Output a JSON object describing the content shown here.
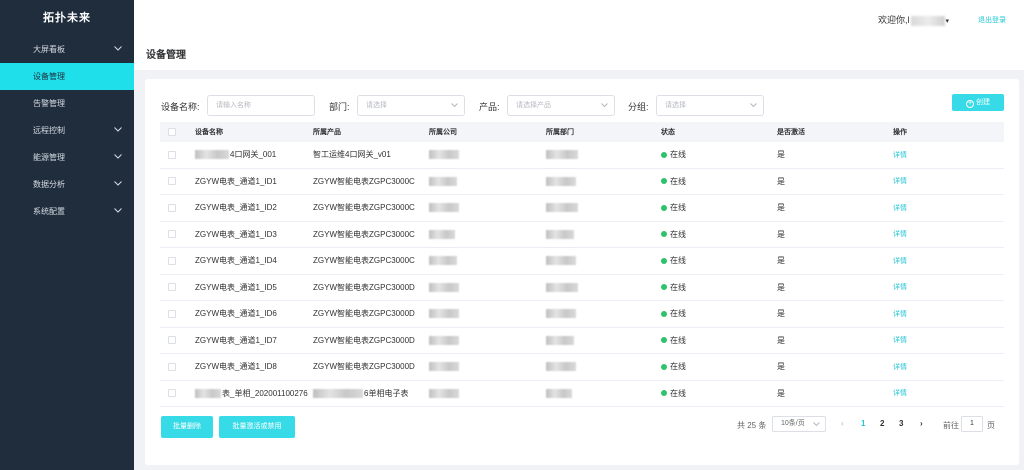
{
  "sidebar": {
    "brand": "拓扑未来",
    "items": [
      {
        "label": "大屏看板",
        "has_children": true,
        "active": false
      },
      {
        "label": "设备管理",
        "has_children": false,
        "active": true
      },
      {
        "label": "告警管理",
        "has_children": false,
        "active": false
      },
      {
        "label": "远程控制",
        "has_children": true,
        "active": false
      },
      {
        "label": "能源管理",
        "has_children": true,
        "active": false
      },
      {
        "label": "数据分析",
        "has_children": true,
        "active": false
      },
      {
        "label": "系统配置",
        "has_children": true,
        "active": false
      }
    ]
  },
  "header": {
    "welcome": "欢迎你,l",
    "logout": "退出登录",
    "page_title": "设备管理"
  },
  "filters": {
    "device_name_label": "设备名称:",
    "device_name_placeholder": "请输入名称",
    "dept_label": "部门:",
    "dept_placeholder": "请选择",
    "product_label": "产品:",
    "product_placeholder": "请选择产品",
    "group_label": "分组:",
    "group_placeholder": "请选择",
    "create_label": "创建"
  },
  "table": {
    "columns": [
      "设备名称",
      "所属产品",
      "所属公司",
      "所属部门",
      "状态",
      "是否激活",
      "操作"
    ],
    "rows": [
      {
        "name": "4口网关_001",
        "name_blur": true,
        "product": "智工运维4口网关_v01",
        "product_blur": false,
        "status": "在线",
        "active": "是",
        "action": "详情"
      },
      {
        "name": "ZGYW电表_通道1_ID1",
        "name_blur": false,
        "product": "ZGYW智能电表ZGPC3000C",
        "product_blur": false,
        "status": "在线",
        "active": "是",
        "action": "详情"
      },
      {
        "name": "ZGYW电表_通道1_ID2",
        "name_blur": false,
        "product": "ZGYW智能电表ZGPC3000C",
        "product_blur": false,
        "status": "在线",
        "active": "是",
        "action": "详情"
      },
      {
        "name": "ZGYW电表_通道1_ID3",
        "name_blur": false,
        "product": "ZGYW智能电表ZGPC3000C",
        "product_blur": false,
        "status": "在线",
        "active": "是",
        "action": "详情"
      },
      {
        "name": "ZGYW电表_通道1_ID4",
        "name_blur": false,
        "product": "ZGYW智能电表ZGPC3000C",
        "product_blur": false,
        "status": "在线",
        "active": "是",
        "action": "详情"
      },
      {
        "name": "ZGYW电表_通道1_ID5",
        "name_blur": false,
        "product": "ZGYW智能电表ZGPC3000D",
        "product_blur": false,
        "status": "在线",
        "active": "是",
        "action": "详情"
      },
      {
        "name": "ZGYW电表_通道1_ID6",
        "name_blur": false,
        "product": "ZGYW智能电表ZGPC3000D",
        "product_blur": false,
        "status": "在线",
        "active": "是",
        "action": "详情"
      },
      {
        "name": "ZGYW电表_通道1_ID7",
        "name_blur": false,
        "product": "ZGYW智能电表ZGPC3000D",
        "product_blur": false,
        "status": "在线",
        "active": "是",
        "action": "详情"
      },
      {
        "name": "ZGYW电表_通道1_ID8",
        "name_blur": false,
        "product": "ZGYW智能电表ZGPC3000D",
        "product_blur": false,
        "status": "在线",
        "active": "是",
        "action": "详情"
      },
      {
        "name": "表_单相_202001100276",
        "name_blur": true,
        "product": "6单相电子表",
        "product_blur": true,
        "status": "在线",
        "active": "是",
        "action": "详情"
      }
    ]
  },
  "footer": {
    "batch_delete": "批量删除",
    "batch_activate": "批量激活或禁用",
    "total": "共 25 条",
    "page_size": "10条/页",
    "pages": [
      "1",
      "2",
      "3"
    ],
    "current_page": "1",
    "goto_label": "前往",
    "goto_value": "1",
    "page_unit": "页"
  },
  "colors": {
    "sidebar_bg": "#1f2d3d",
    "accent": "#1fe0ea",
    "online_dot": "#2dc26b"
  }
}
